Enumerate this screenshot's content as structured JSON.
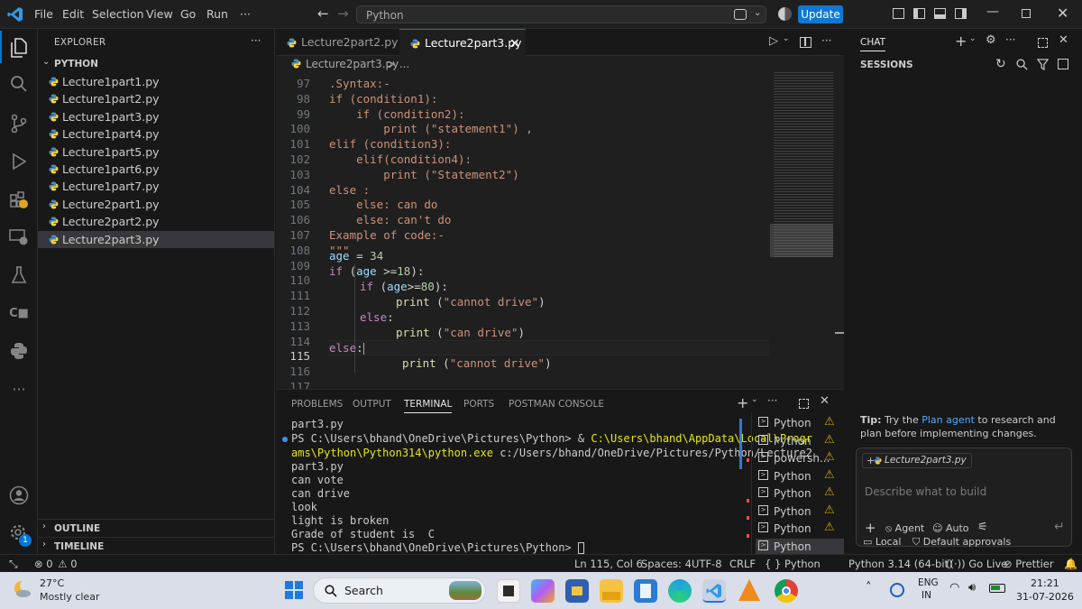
{
  "titlebar": {
    "menus": [
      "File",
      "Edit",
      "Selection",
      "View",
      "Go",
      "Run",
      "···"
    ],
    "search_text": "Python",
    "update_label": "Update"
  },
  "sidebar": {
    "title": "EXPLORER",
    "more": "···",
    "folder": "PYTHON",
    "files": [
      "Lecture1part1.py",
      "Lecture1part2.py",
      "Lecture1part3.py",
      "Lecture1part4.py",
      "Lecture1part5.py",
      "Lecture1part6.py",
      "Lecture1part7.py",
      "Lecture2part1.py",
      "Lecture2part2.py",
      "Lecture2part3.py"
    ],
    "selected_index": 9,
    "outline": "OUTLINE",
    "timeline": "TIMELINE",
    "badge": "1"
  },
  "tabs": [
    {
      "label": "Lecture2part2.py",
      "active": false
    },
    {
      "label": "Lecture2part3.py",
      "active": true,
      "close": "×"
    }
  ],
  "breadcrumb": {
    "file": "Lecture2part3.py",
    "rest": "> ..."
  },
  "editor": {
    "current_line": 115,
    "lines": [
      {
        "n": 97,
        "text": ".Syntax:-"
      },
      {
        "n": 98,
        "text": "if (condition1):"
      },
      {
        "n": 99,
        "text": "    if (condition2):"
      },
      {
        "n": 100,
        "text": "        print (\"statement1\") ,"
      },
      {
        "n": 101,
        "text": "elif (condition3):"
      },
      {
        "n": 102,
        "text": "    elif(condition4):"
      },
      {
        "n": 103,
        "text": "        print (\"Statement2\")"
      },
      {
        "n": 104,
        "text": "else :"
      },
      {
        "n": 105,
        "text": "    else: can do"
      },
      {
        "n": 106,
        "text": "    else: can't do"
      },
      {
        "n": 107,
        "text": "Example of code:-"
      },
      {
        "n": 108,
        "text": "\"\"\""
      },
      {
        "n": 109,
        "text": ""
      },
      {
        "n": 110,
        "text": ""
      },
      {
        "n": 111,
        "text": ""
      },
      {
        "n": 112,
        "text": ""
      },
      {
        "n": 113,
        "text": ""
      },
      {
        "n": 114,
        "text": ""
      },
      {
        "n": 115,
        "text": ""
      },
      {
        "n": 116,
        "text": ""
      },
      {
        "n": 117,
        "text": ""
      }
    ],
    "code": {
      "l109_var": "age",
      "l109_op": " = ",
      "l109_num": "34",
      "l110_kw": "if",
      "l110_a": " (",
      "l110_var": "age",
      "l110_b": " >=",
      "l110_num": "18",
      "l110_c": "):",
      "l111_kw": "if",
      "l111_a": " (",
      "l111_var": "age",
      "l111_b": ">=",
      "l111_num": "80",
      "l111_c": "):",
      "l112_fn": "print",
      "l112_a": " (",
      "l112_str": "\"cannot drive\"",
      "l112_b": ")",
      "l113_kw": "else",
      "l114_fn": "print",
      "l114_a": " (",
      "l114_str": "\"can drive\"",
      "l114_b": ")",
      "l115_kw": "else",
      "l116_fn": "print",
      "l116_a": " (",
      "l116_str": "\"cannot drive\"",
      "l116_b": ")"
    }
  },
  "panel": {
    "tabs": [
      "PROBLEMS",
      "OUTPUT",
      "TERMINAL",
      "PORTS",
      "POSTMAN CONSOLE"
    ],
    "active_tab": "TERMINAL",
    "terminal_lines": [
      "part3.py",
      "PS C:\\Users\\bhand\\OneDrive\\Pictures\\Python> & ",
      "ams\\Python\\Python314\\python.exe",
      "part3.py",
      "can vote",
      "can drive",
      "look",
      "light is broken",
      "Grade of student is  C",
      "PS C:\\Users\\bhand\\OneDrive\\Pictures\\Python> "
    ],
    "path_yellow_1": "C:\\Users\\bhand\\AppData\\Local\\Progr",
    "path_rest": " c:/Users/bhand/OneDrive/Pictures/Python/Lecture2",
    "terminals": [
      "Python",
      "Python",
      "powersh...",
      "Python",
      "Python",
      "Python",
      "Python",
      "Python"
    ]
  },
  "chat": {
    "title": "CHAT",
    "sessions": "SESSIONS",
    "tip_label": "Tip:",
    "tip_pre": " Try the ",
    "tip_link": "Plan agent",
    "tip_post": " to research and plan before implementing changes.",
    "context_file": "Lecture2part3.py",
    "input_placeholder": "Describe what to build",
    "agent_label": "Agent",
    "auto_label": "Auto",
    "local_label": "Local",
    "approvals_label": "Default approvals"
  },
  "statusbar": {
    "errors": "0",
    "warnings": "0",
    "position": "Ln 115, Col 6",
    "spaces": "Spaces: 4",
    "encoding": "UTF-8",
    "eol": "CRLF",
    "language": "Python",
    "interpreter": "Python 3.14 (64-bit)",
    "golive": "Go Live",
    "prettier": "Prettier"
  },
  "taskbar": {
    "temp": "27°C",
    "weather": "Mostly clear",
    "search": "Search",
    "lang1": "ENG",
    "lang2": "IN",
    "time": "21:21",
    "date": "31-07-2026"
  }
}
